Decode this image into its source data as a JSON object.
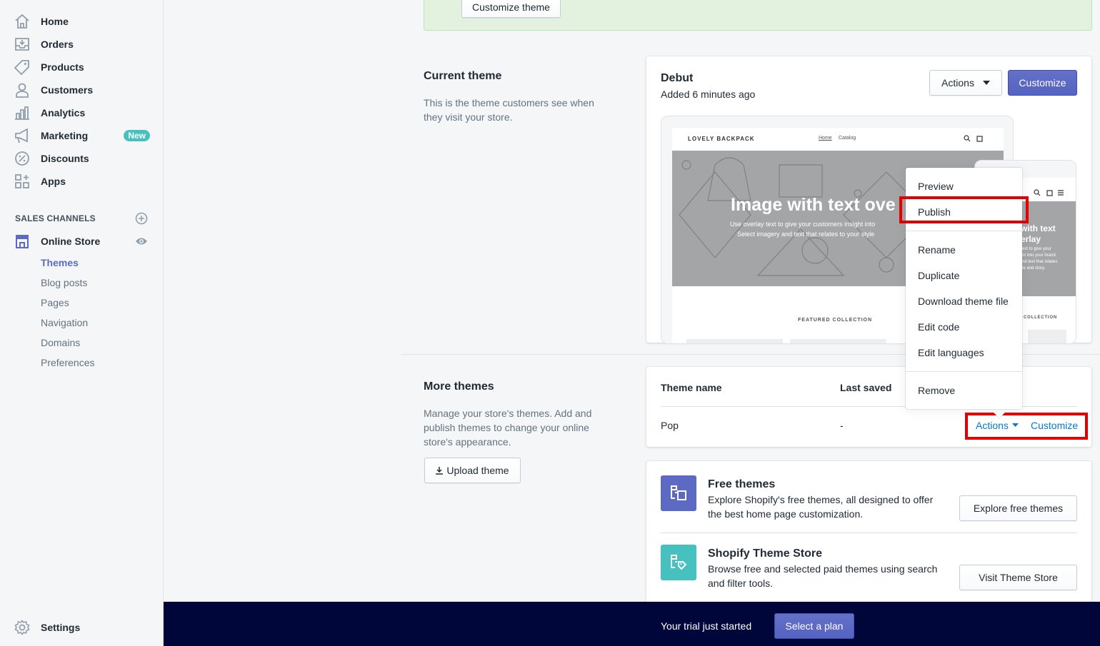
{
  "sidebar": {
    "items": [
      {
        "label": "Home",
        "icon": "home-icon"
      },
      {
        "label": "Orders",
        "icon": "orders-icon"
      },
      {
        "label": "Products",
        "icon": "tag-icon"
      },
      {
        "label": "Customers",
        "icon": "person-icon"
      },
      {
        "label": "Analytics",
        "icon": "bar-chart-icon"
      },
      {
        "label": "Marketing",
        "icon": "megaphone-icon"
      },
      {
        "label": "Discounts",
        "icon": "discount-icon"
      },
      {
        "label": "Apps",
        "icon": "apps-icon"
      }
    ],
    "marketing_badge": "New",
    "sales_channels_title": "SALES CHANNELS",
    "online_store": "Online Store",
    "sub_items": [
      "Themes",
      "Blog posts",
      "Pages",
      "Navigation",
      "Domains",
      "Preferences"
    ],
    "settings": "Settings"
  },
  "banner": {
    "customize_theme_label": "Customize theme"
  },
  "current_theme": {
    "section_title": "Current theme",
    "section_desc": "This is the theme customers see when they visit your store.",
    "theme_name": "Debut",
    "added": "Added 6 minutes ago",
    "actions_label": "Actions",
    "customize_label": "Customize",
    "preview": {
      "store_name": "LOVELY BACKPACK",
      "nav_home": "Home",
      "nav_catalog": "Catalog",
      "hero_title": "Image with text ove",
      "hero_line1": "Use overlay text to give your customers insight into",
      "hero_line2": "Select imagery and text that relates to your style",
      "featured": "FEATURED COLLECTION",
      "mobile_hero1": "with text",
      "mobile_hero2": "erlay",
      "mobile_line1": "ext to give your",
      "mobile_line2": "nt into your brand.",
      "mobile_line3": "nd text that relates",
      "mobile_line4": "le and story.",
      "mobile_collection": "COLLECTION"
    }
  },
  "actions_menu": {
    "items_group1": [
      "Preview",
      "Publish"
    ],
    "items_group2": [
      "Rename",
      "Duplicate",
      "Download theme file",
      "Edit code",
      "Edit languages"
    ],
    "items_group3": [
      "Remove"
    ]
  },
  "more_themes": {
    "section_title": "More themes",
    "section_desc": "Manage your store's themes. Add and publish themes to change your online store's appearance.",
    "upload_label": "Upload theme",
    "col_name": "Theme name",
    "col_saved": "Last saved",
    "row": {
      "name": "Pop",
      "saved": "-",
      "actions": "Actions",
      "customize": "Customize"
    }
  },
  "free_themes": {
    "title": "Free themes",
    "desc": "Explore Shopify's free themes, all designed to offer the best home page customization.",
    "button": "Explore free themes"
  },
  "theme_store": {
    "title": "Shopify Theme Store",
    "desc": "Browse free and selected paid themes using search and filter tools.",
    "button": "Visit Theme Store"
  },
  "trial_bar": {
    "text": "Your trial just started",
    "button": "Select a plan"
  },
  "colors": {
    "accent": "#5c6ac4",
    "link": "#007ace",
    "highlight": "#e50000",
    "bar": "#000639"
  }
}
